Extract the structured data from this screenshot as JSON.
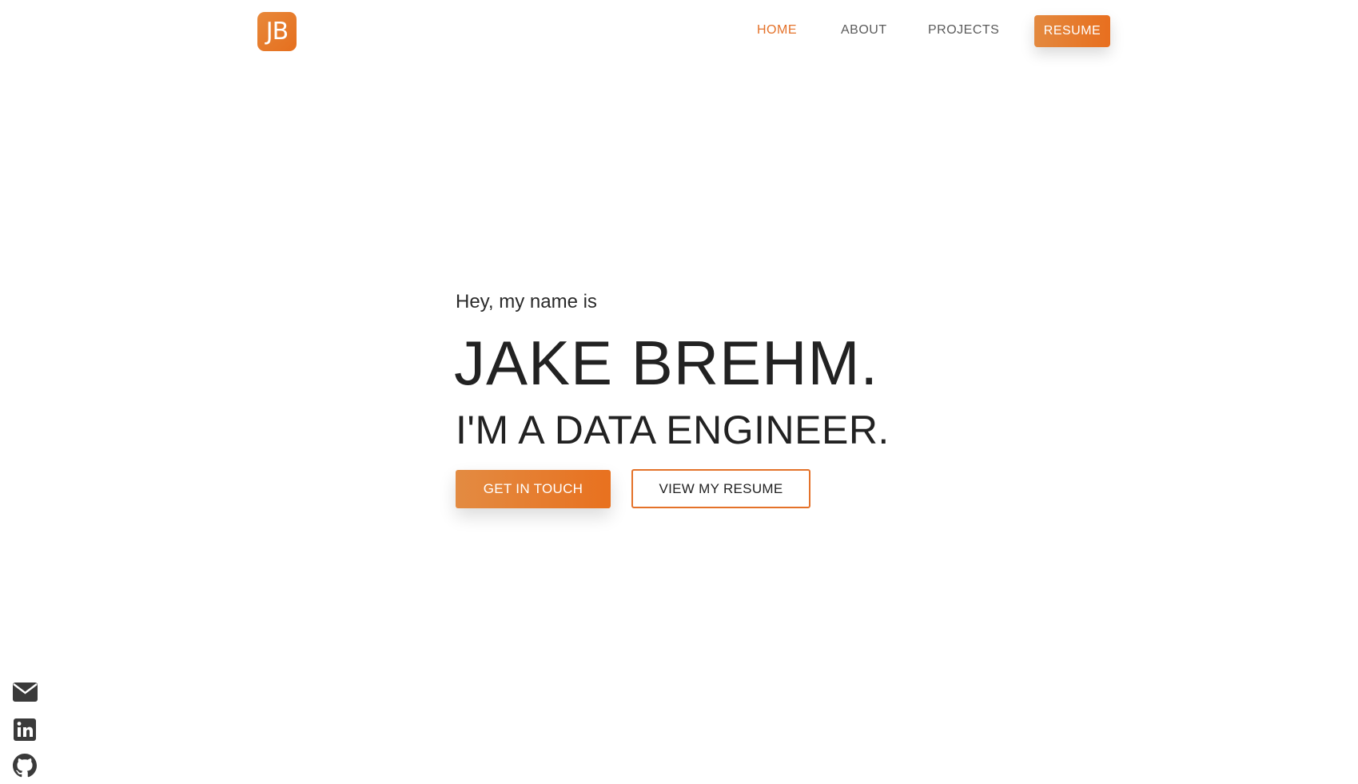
{
  "brand": {
    "logo_text": "JB",
    "accent_color": "#e4722a"
  },
  "nav": {
    "items": [
      {
        "label": "HOME",
        "active": true
      },
      {
        "label": "ABOUT",
        "active": false
      },
      {
        "label": "PROJECTS",
        "active": false
      }
    ],
    "resume_button": "RESUME"
  },
  "hero": {
    "greeting": "Hey, my name is",
    "name": "JAKE BREHM.",
    "role": "I'M A DATA ENGINEER.",
    "primary_button": "GET IN TOUCH",
    "secondary_button": "VIEW MY RESUME"
  },
  "social": [
    {
      "icon": "envelope-icon"
    },
    {
      "icon": "linkedin-icon"
    },
    {
      "icon": "github-icon"
    }
  ]
}
